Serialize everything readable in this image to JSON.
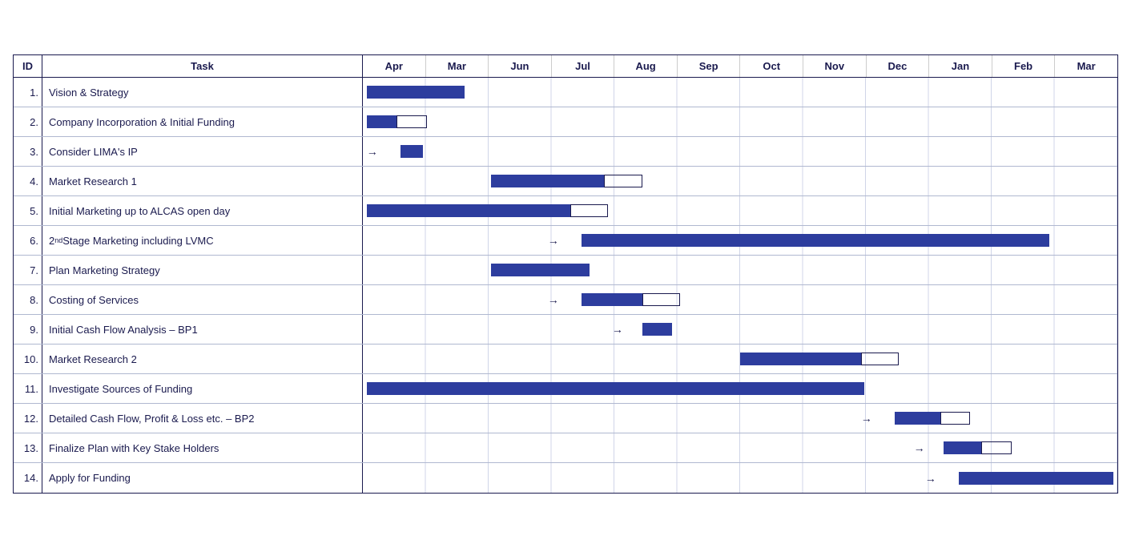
{
  "header": {
    "col_id": "ID",
    "col_task": "Task",
    "months": [
      "Apr",
      "Mar",
      "Jun",
      "Jul",
      "Aug",
      "Sep",
      "Oct",
      "Nov",
      "Dec",
      "Jan",
      "Feb",
      "Mar"
    ]
  },
  "rows": [
    {
      "id": "1.",
      "task": "Vision & Strategy"
    },
    {
      "id": "2.",
      "task": "Company Incorporation & Initial Funding"
    },
    {
      "id": "3.",
      "task": "Consider LIMA's IP"
    },
    {
      "id": "4.",
      "task": "Market Research 1"
    },
    {
      "id": "5.",
      "task": "Initial Marketing up to ALCAS open day"
    },
    {
      "id": "6.",
      "task": "2nd Stage Marketing including LVMC"
    },
    {
      "id": "7.",
      "task": "Plan Marketing Strategy"
    },
    {
      "id": "8.",
      "task": "Costing of Services"
    },
    {
      "id": "9.",
      "task": "Initial Cash Flow Analysis – BP1"
    },
    {
      "id": "10.",
      "task": "Market Research 2"
    },
    {
      "id": "11.",
      "task": "Investigate Sources of Funding"
    },
    {
      "id": "12.",
      "task": "Detailed Cash Flow, Profit & Loss etc. – BP2"
    },
    {
      "id": "13.",
      "task": "Finalize Plan with Key Stake Holders"
    },
    {
      "id": "14.",
      "task": "Apply for Funding"
    }
  ]
}
